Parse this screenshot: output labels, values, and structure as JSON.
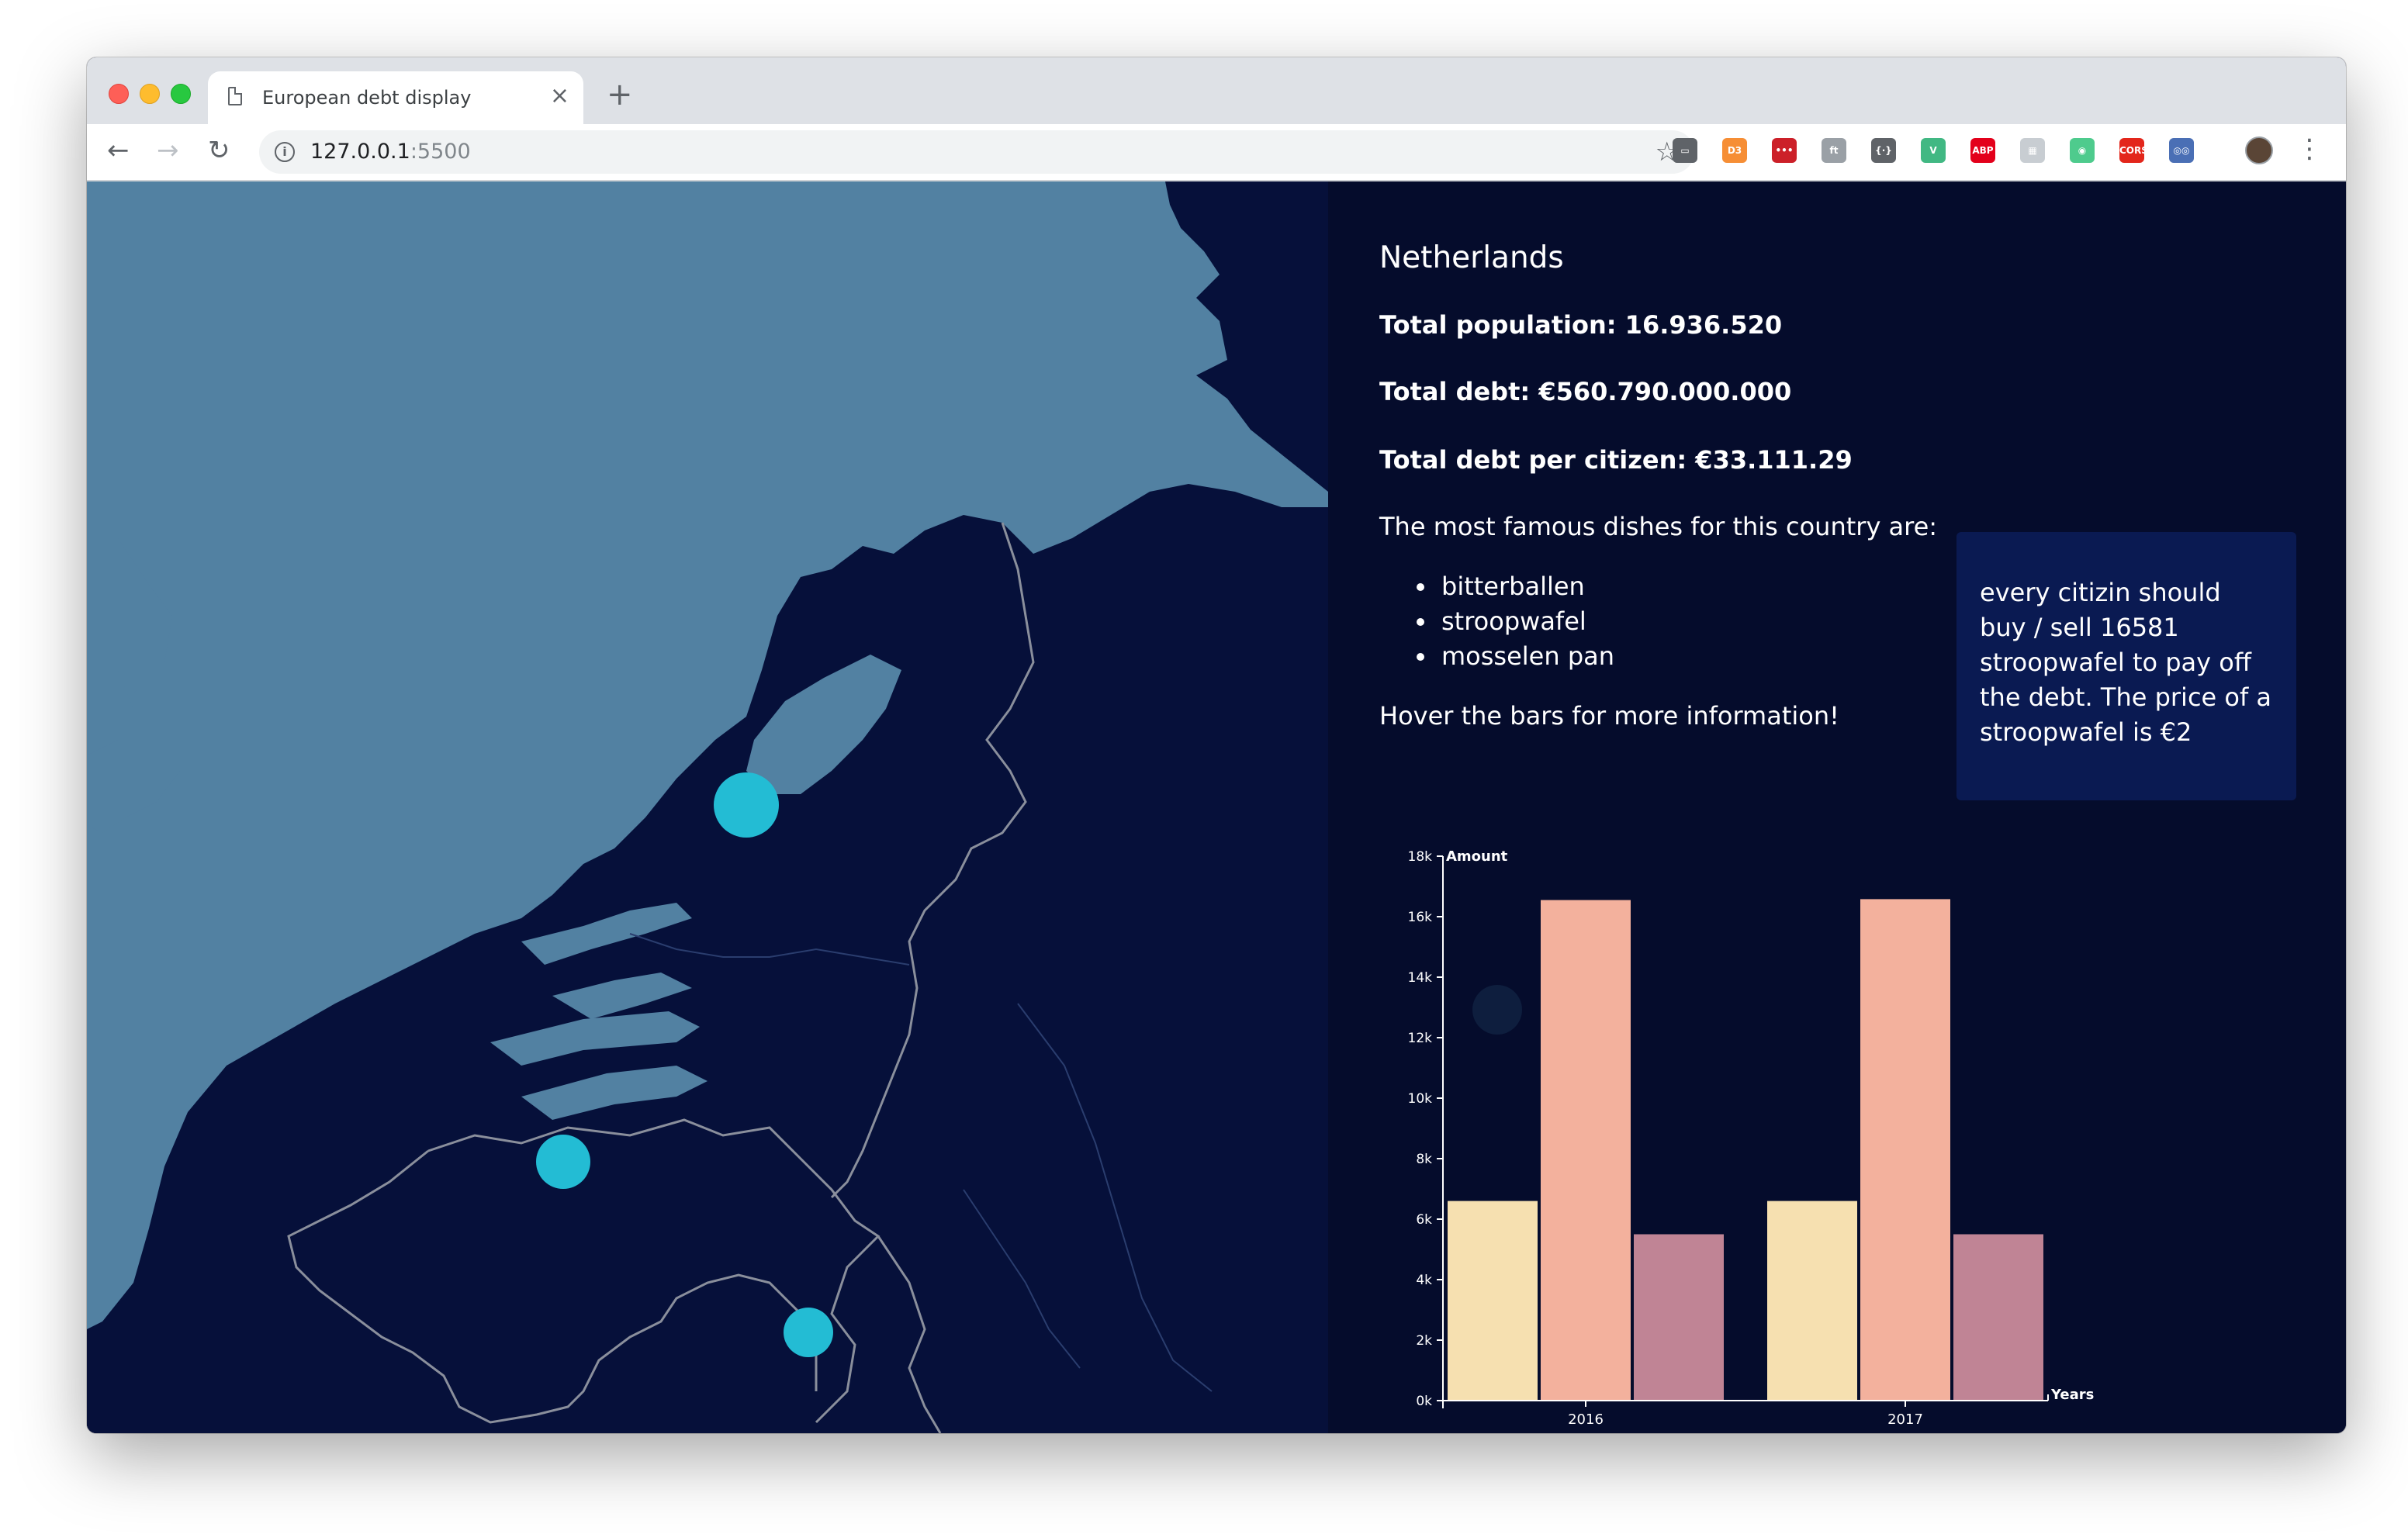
{
  "browser": {
    "tab_title": "European debt display",
    "tab_close": "×",
    "new_tab": "+",
    "url_host": "127.0.0.1",
    "url_port": ":5500",
    "back": "←",
    "forward": "→",
    "reload": "↻",
    "bookmark": "☆",
    "menu": "⋮",
    "extensions": [
      {
        "name": "cast-icon",
        "label": "▭",
        "color": "#5f6368"
      },
      {
        "name": "d3-extension-icon",
        "label": "D3",
        "color": "#f68e35"
      },
      {
        "name": "lastpass-extension-icon",
        "label": "•••",
        "color": "#cc2029"
      },
      {
        "name": "font-extension-icon",
        "label": "ft",
        "color": "#9aa0a6"
      },
      {
        "name": "code-extension-icon",
        "label": "{·}",
        "color": "#5f6368"
      },
      {
        "name": "vue-devtools-icon",
        "label": "V",
        "color": "#41b883"
      },
      {
        "name": "adblock-plus-icon",
        "label": "ABP",
        "color": "#e3001b"
      },
      {
        "name": "grid-extension-icon",
        "label": "▦",
        "color": "#c8cdd2"
      },
      {
        "name": "color-picker-icon",
        "label": "◉",
        "color": "#4ecb8d"
      },
      {
        "name": "cors-extension-icon",
        "label": "CORS",
        "color": "#e3261b"
      },
      {
        "name": "mascot-extension-icon",
        "label": "◎◎",
        "color": "#4a6fb5"
      }
    ]
  },
  "country": {
    "name": "Netherlands",
    "population": "Total population: 16.936.520",
    "debt": "Total debt: €560.790.000.000",
    "debt_per_citizen": "Total debt per citizen: €33.111.29",
    "dishes_intro": "The most famous dishes for this country are:",
    "dishes": [
      "bitterballen",
      "stroopwafel",
      "mosselen pan"
    ],
    "hover_hint": "Hover the bars for more information!"
  },
  "tooltip": {
    "text": "every citizin should buy / sell 16581 stroopwafel to pay off the debt. The price of a stroopwafel is €2"
  },
  "map": {
    "sea_color": "#5281a2",
    "land_color": "#06103a",
    "border_color": "#8a8f9c",
    "marker_color": "#23bcd4"
  },
  "chart_data": {
    "type": "bar",
    "categories": [
      "2016",
      "2017"
    ],
    "series": [
      {
        "values": [
          6600,
          6600
        ],
        "color": "#f6e0b0"
      },
      {
        "values": [
          16550,
          16580
        ],
        "color": "#f3b19d"
      },
      {
        "values": [
          5500,
          5500
        ],
        "color": "#c08495"
      }
    ],
    "ylabel": "Amount",
    "xlabel": "Years",
    "ylim": [
      0,
      18000
    ],
    "yticks": [
      "0k",
      "2k",
      "4k",
      "6k",
      "8k",
      "10k",
      "12k",
      "14k",
      "16k",
      "18k"
    ],
    "grid": false,
    "legend": "none"
  }
}
